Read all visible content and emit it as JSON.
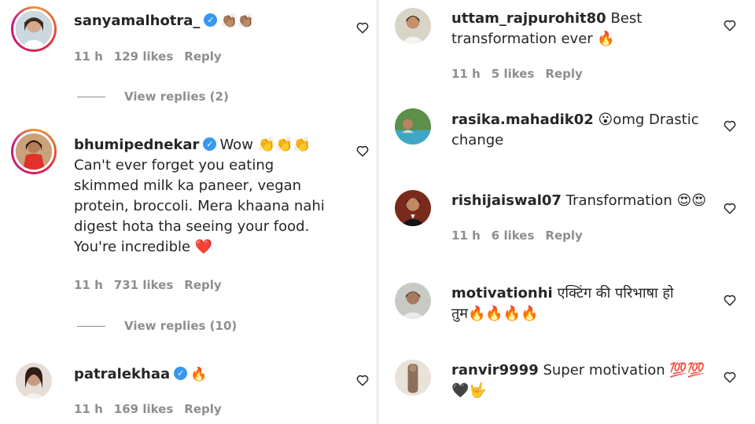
{
  "left_column": [
    {
      "username": "sanyamalhotra_",
      "verified": true,
      "text": "👏🏽👏🏽",
      "time": "11 h",
      "likes": "129 likes",
      "reply_label": "Reply",
      "view_replies": "View replies (2)"
    },
    {
      "username": "bhumipednekar",
      "verified": true,
      "text_lines": [
        "Wow 👏👏👏",
        "Can't ever forget you eating",
        "skimmed milk ka paneer, vegan",
        "protein, broccoli. Mera khaana nahi",
        "digest hota tha seeing your food.",
        "You're incredible ❤️"
      ],
      "time": "11 h",
      "likes": "731 likes",
      "reply_label": "Reply",
      "view_replies": "View replies (10)"
    },
    {
      "username": "patralekhaa",
      "verified": true,
      "text": "🔥",
      "time": "11 h",
      "likes": "169 likes",
      "reply_label": "Reply"
    }
  ],
  "right_column": [
    {
      "username": "uttam_rajpurohit80",
      "text_lines": [
        "Best",
        "transformation ever 🔥"
      ],
      "time": "11 h",
      "likes": "5 likes",
      "reply_label": "Reply"
    },
    {
      "username": "rasika.mahadik02",
      "text_lines": [
        "😮omg Drastic",
        "change"
      ]
    },
    {
      "username": "rishijaiswal07",
      "text": "Transformation 😍😍",
      "time": "11 h",
      "likes": "6 likes",
      "reply_label": "Reply"
    },
    {
      "username": "motivationhi",
      "text_lines": [
        "एक्टिंग की परिभाषा हो",
        "तुम🔥🔥🔥🔥"
      ]
    },
    {
      "username": "ranvir9999",
      "text_lines": [
        "Super motivation 💯💯",
        "🖤🤟"
      ]
    }
  ],
  "icons": {
    "like": "heart-outline-icon",
    "verified": "verified-badge-icon"
  },
  "colors": {
    "text": "#262626",
    "meta": "#8e8e8e",
    "verified": "#3897f0"
  }
}
